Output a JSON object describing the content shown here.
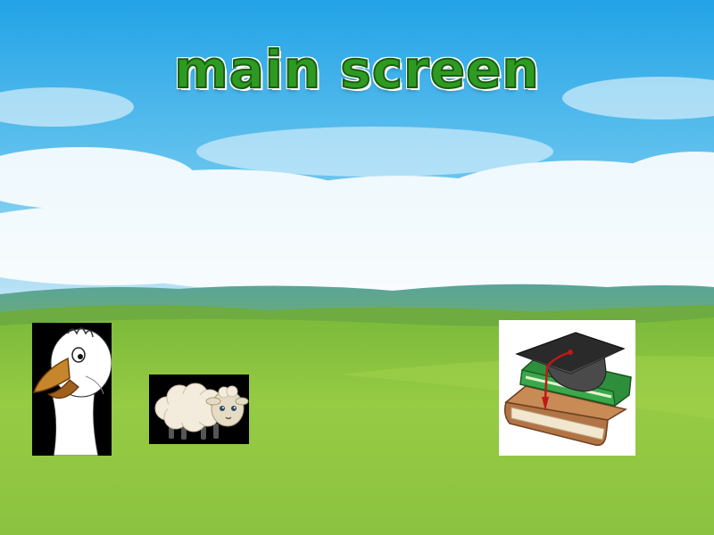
{
  "screen": {
    "title": "main screen"
  },
  "tiles": [
    {
      "id": "goose",
      "icon": "goose-icon"
    },
    {
      "id": "sheep",
      "icon": "sheep-icon"
    },
    {
      "id": "education",
      "icon": "graduation-books-icon"
    }
  ],
  "colors": {
    "sky_top": "#2aa6e6",
    "sky_bottom": "#d6eef8",
    "grass": "#8cc63f",
    "title_green": "#2f9a22"
  }
}
